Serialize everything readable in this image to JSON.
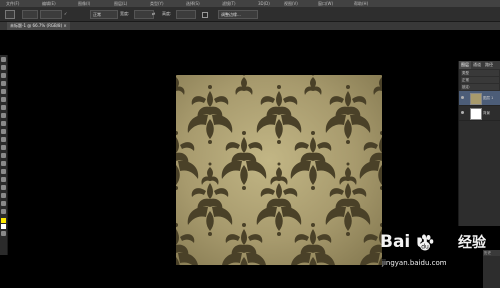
{
  "menubar": {
    "items": [
      "文件(F)",
      "编辑(E)",
      "图像(I)",
      "图层(L)",
      "类型(Y)",
      "选择(S)",
      "滤镜(T)",
      "3D(D)",
      "视图(V)",
      "窗口(W)",
      "帮助(H)"
    ]
  },
  "options": {
    "mode_value": "",
    "style_value": "正常",
    "width_label": "宽度:",
    "height_label": "高度:",
    "refine_label": "调整边缘..."
  },
  "document_tab": {
    "label": "未标题-1 @ 66.7% (RGB/8) ×"
  },
  "layers_panel": {
    "tabs": [
      "图层",
      "通道",
      "路径"
    ],
    "kind_label": "类型",
    "blend_mode": "正常",
    "lock_label": "锁定:",
    "layers": [
      {
        "name": "图层 1",
        "selected": true,
        "thumb": "pattern"
      },
      {
        "name": "背景",
        "selected": false,
        "thumb": "white"
      }
    ]
  },
  "history_panel": {
    "tab": "历史"
  },
  "watermark": {
    "logo_text": "Bai  u",
    "logo_suffix": "经验",
    "url": "jingyan.baidu.com"
  },
  "colors": {
    "pattern_background": "#a79a6d",
    "pattern_motif": "#4a4128",
    "foreground_color": "#ffea00",
    "background_color": "#ffffff",
    "workspace": "#000000"
  }
}
